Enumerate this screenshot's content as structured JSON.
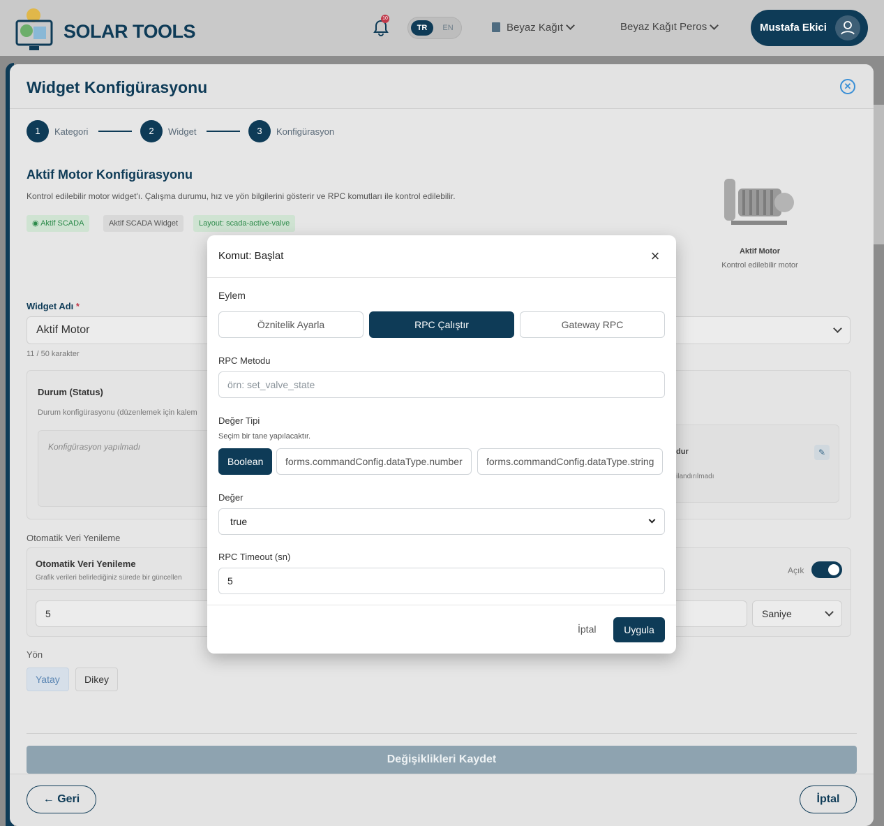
{
  "app": {
    "brand": "SOLAR TOOLS",
    "notification_badge": "10",
    "lang_tr": "TR",
    "lang_en": "EN",
    "doc_selector": "Beyaz Kağıt",
    "org_selector": "Beyaz Kağıt Peros",
    "user_name": "Mustafa Ekici"
  },
  "panel": {
    "title": "Widget Konfigürasyonu",
    "steps": [
      {
        "num": "1",
        "label": "Kategori"
      },
      {
        "num": "2",
        "label": "Widget"
      },
      {
        "num": "3",
        "label": "Konfigürasyon"
      }
    ],
    "section_title": "Aktif Motor Konfigürasyonu",
    "section_desc": "Kontrol edilebilir motor widget'ı. Çalışma durumu, hız ve yön bilgilerini gösterir ve RPC komutları ile kontrol edilebilir.",
    "tags": [
      "Aktif SCADA",
      "Aktif SCADA Widget",
      "Layout: scada-active-valve"
    ],
    "preview_name": "Aktif Motor",
    "preview_desc": "Kontrol edilebilir motor",
    "widget_name_label": "Widget Adı",
    "widget_name_value": "Aktif Motor",
    "char_count": "11 / 50 karakter",
    "status_title": "Durum (Status)",
    "status_desc": "Durum konfigürasyonu (düzenlemek için kalem",
    "status_empty": "Konfigürasyon yapılmadı",
    "right_card_title": "dur",
    "right_card_sub": "ilandırılmadı",
    "auto_refresh_section": "Otomatik Veri Yenileme",
    "auto_refresh_title": "Otomatik Veri Yenileme",
    "auto_refresh_desc": "Grafik verileri belirlediğiniz sürede bir güncellen",
    "toggle_label": "Açık",
    "toggle_on": true,
    "refresh_value": "5",
    "refresh_unit": "Saniye",
    "direction_label": "Yön",
    "direction_horizontal": "Yatay",
    "direction_vertical": "Dikey",
    "save_label": "Değişiklikleri Kaydet",
    "back_label": "← Geri",
    "cancel_label": "İptal"
  },
  "modal": {
    "title": "Komut: Başlat",
    "action_label": "Eylem",
    "actions": [
      "Öznitelik Ayarla",
      "RPC Çalıştır",
      "Gateway RPC"
    ],
    "active_action": "RPC Çalıştır",
    "rpc_method_label": "RPC Metodu",
    "rpc_method_placeholder": "örn: set_valve_state",
    "value_type_label": "Değer Tipi",
    "value_type_hint": "Seçim bir tane yapılacaktır.",
    "value_types": [
      "Boolean",
      "forms.commandConfig.dataType.number",
      "forms.commandConfig.dataType.string"
    ],
    "active_value_type": "Boolean",
    "value_label": "Değer",
    "value_selected": "true",
    "timeout_label": "RPC Timeout (sn)",
    "timeout_value": "5",
    "cancel_label": "İptal",
    "apply_label": "Uygula"
  },
  "colors": {
    "primary": "#0e3b57",
    "accent_green": "#2c8a4a",
    "link_blue": "#3a8fd6"
  }
}
